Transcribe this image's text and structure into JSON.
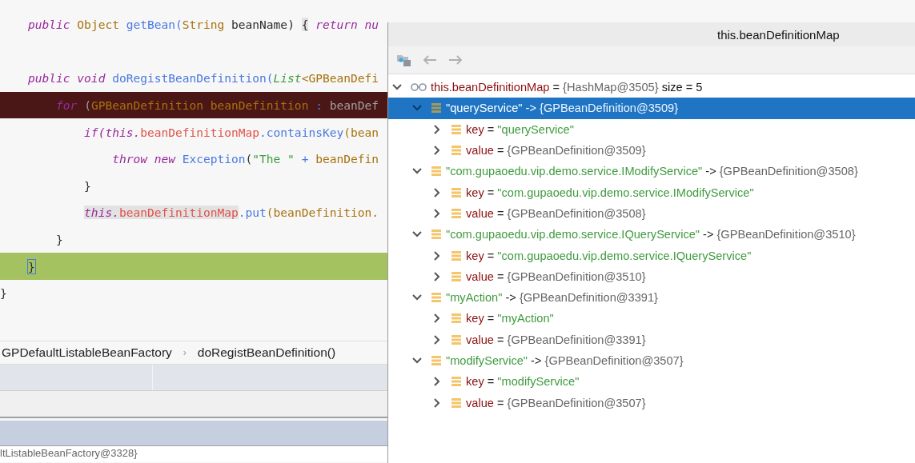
{
  "editor": {
    "lines": [
      {
        "kind": "normal",
        "tokens": [
          {
            "kind": "keyword",
            "t": "    public "
          },
          {
            "kind": "type",
            "t": "Object "
          },
          {
            "kind": "method",
            "t": "getBean("
          },
          {
            "kind": "type",
            "t": "String "
          },
          {
            "kind": "plain",
            "t": "beanName) "
          },
          {
            "kind": "plain",
            "t": "{",
            "highlighted": true
          },
          {
            "kind": "keyword",
            "t": " return nu"
          }
        ]
      },
      {
        "kind": "normal"
      },
      {
        "kind": "normal",
        "tokens": [
          {
            "kind": "keyword",
            "t": "    public void "
          },
          {
            "kind": "method",
            "t": "doRegistBeanDefinition("
          },
          {
            "kind": "generic",
            "t": "List"
          },
          {
            "kind": "type",
            "t": "<GPBeanDefi"
          }
        ]
      },
      {
        "kind": "breakpoint",
        "tokens": [
          {
            "kind": "keyword",
            "t": "        for "
          },
          {
            "kind": "dim",
            "t": "("
          },
          {
            "kind": "type",
            "t": "GPBeanDefinition beanDefinition "
          },
          {
            "kind": "method",
            "t": ": "
          },
          {
            "kind": "dim",
            "t": "beanDef"
          }
        ]
      },
      {
        "kind": "normal",
        "tokens": [
          {
            "kind": "keyword",
            "t": "            if(this."
          },
          {
            "kind": "field",
            "t": "beanDefinitionMap"
          },
          {
            "kind": "method",
            "t": ".containsKey"
          },
          {
            "kind": "type",
            "t": "(bean"
          }
        ]
      },
      {
        "kind": "normal",
        "tokens": [
          {
            "kind": "keyword",
            "t": "                throw new "
          },
          {
            "kind": "method",
            "t": "Exception"
          },
          {
            "kind": "plain",
            "t": "("
          },
          {
            "kind": "string",
            "t": "\"The \""
          },
          {
            "kind": "method",
            "t": " + "
          },
          {
            "kind": "type",
            "t": "beanDefin"
          }
        ]
      },
      {
        "kind": "normal",
        "tokens": [
          {
            "kind": "plain",
            "t": "            }"
          }
        ]
      },
      {
        "kind": "normal",
        "tokens": [
          {
            "kind": "keyword",
            "t": "            this.",
            "highlighted": true
          },
          {
            "kind": "field",
            "t": "beanDefinitionMap",
            "highlighted": true
          },
          {
            "kind": "method",
            "t": ".put"
          },
          {
            "kind": "type",
            "t": "(beanDefinition."
          }
        ]
      },
      {
        "kind": "normal",
        "tokens": [
          {
            "kind": "plain",
            "t": "        }"
          }
        ]
      },
      {
        "kind": "current",
        "tokens": [
          {
            "kind": "plain",
            "t": "    }",
            "caret": true
          }
        ]
      },
      {
        "kind": "normal",
        "tokens": [
          {
            "kind": "plain",
            "t": "}"
          }
        ]
      }
    ]
  },
  "breadcrumb": {
    "items": [
      "GPDefaultListableBeanFactory",
      "doRegistBeanDefinition()"
    ],
    "separator": "›"
  },
  "frame_text": "ltListableBeanFactory@3328}",
  "popup": {
    "title": "this.beanDefinitionMap",
    "tree": [
      {
        "kind": "watch",
        "name": {
          "kind": "field",
          "text": "this.beanDefinitionMap"
        },
        "op": " = ",
        "value": {
          "kind": "object",
          "text": "{HashMap@3505}"
        },
        "suffix": "size = 5",
        "expanded": true,
        "selected": false,
        "children": [
          {
            "kind": "entry",
            "name": {
              "kind": "string",
              "text": "\"queryService\""
            },
            "op": " -> ",
            "value": {
              "kind": "object",
              "text": "{GPBeanDefinition@3509}"
            },
            "expanded": true,
            "selected": true,
            "children": [
              {
                "kind": "entry",
                "name": {
                  "kind": "field",
                  "text": "key"
                },
                "op": " = ",
                "value": {
                  "kind": "string",
                  "text": "\"queryService\""
                },
                "expanded": false,
                "selected": false
              },
              {
                "kind": "entry",
                "name": {
                  "kind": "field",
                  "text": "value"
                },
                "op": " = ",
                "value": {
                  "kind": "object",
                  "text": "{GPBeanDefinition@3509}"
                },
                "expanded": false,
                "selected": false
              }
            ]
          },
          {
            "kind": "entry",
            "name": {
              "kind": "string",
              "text": "\"com.gupaoedu.vip.demo.service.IModifyService\""
            },
            "op": " -> ",
            "value": {
              "kind": "object",
              "text": "{GPBeanDefinition@3508}"
            },
            "expanded": true,
            "selected": false,
            "children": [
              {
                "kind": "entry",
                "name": {
                  "kind": "field",
                  "text": "key"
                },
                "op": " = ",
                "value": {
                  "kind": "string",
                  "text": "\"com.gupaoedu.vip.demo.service.IModifyService\""
                },
                "expanded": false,
                "selected": false
              },
              {
                "kind": "entry",
                "name": {
                  "kind": "field",
                  "text": "value"
                },
                "op": " = ",
                "value": {
                  "kind": "object",
                  "text": "{GPBeanDefinition@3508}"
                },
                "expanded": false,
                "selected": false
              }
            ]
          },
          {
            "kind": "entry",
            "name": {
              "kind": "string",
              "text": "\"com.gupaoedu.vip.demo.service.IQueryService\""
            },
            "op": " -> ",
            "value": {
              "kind": "object",
              "text": "{GPBeanDefinition@3510}"
            },
            "expanded": true,
            "selected": false,
            "children": [
              {
                "kind": "entry",
                "name": {
                  "kind": "field",
                  "text": "key"
                },
                "op": " = ",
                "value": {
                  "kind": "string",
                  "text": "\"com.gupaoedu.vip.demo.service.IQueryService\""
                },
                "expanded": false,
                "selected": false
              },
              {
                "kind": "entry",
                "name": {
                  "kind": "field",
                  "text": "value"
                },
                "op": " = ",
                "value": {
                  "kind": "object",
                  "text": "{GPBeanDefinition@3510}"
                },
                "expanded": false,
                "selected": false
              }
            ]
          },
          {
            "kind": "entry",
            "name": {
              "kind": "string",
              "text": "\"myAction\""
            },
            "op": " -> ",
            "value": {
              "kind": "object",
              "text": "{GPBeanDefinition@3391}"
            },
            "expanded": true,
            "selected": false,
            "children": [
              {
                "kind": "entry",
                "name": {
                  "kind": "field",
                  "text": "key"
                },
                "op": " = ",
                "value": {
                  "kind": "string",
                  "text": "\"myAction\""
                },
                "expanded": false,
                "selected": false
              },
              {
                "kind": "entry",
                "name": {
                  "kind": "field",
                  "text": "value"
                },
                "op": " = ",
                "value": {
                  "kind": "object",
                  "text": "{GPBeanDefinition@3391}"
                },
                "expanded": false,
                "selected": false
              }
            ]
          },
          {
            "kind": "entry",
            "name": {
              "kind": "string",
              "text": "\"modifyService\""
            },
            "op": " -> ",
            "value": {
              "kind": "object",
              "text": "{GPBeanDefinition@3507}"
            },
            "expanded": true,
            "selected": false,
            "children": [
              {
                "kind": "entry",
                "name": {
                  "kind": "field",
                  "text": "key"
                },
                "op": " = ",
                "value": {
                  "kind": "string",
                  "text": "\"modifyService\""
                },
                "expanded": false,
                "selected": false
              },
              {
                "kind": "entry",
                "name": {
                  "kind": "field",
                  "text": "value"
                },
                "op": " = ",
                "value": {
                  "kind": "object",
                  "text": "{GPBeanDefinition@3507}"
                },
                "expanded": false,
                "selected": false
              }
            ]
          }
        ]
      }
    ]
  }
}
